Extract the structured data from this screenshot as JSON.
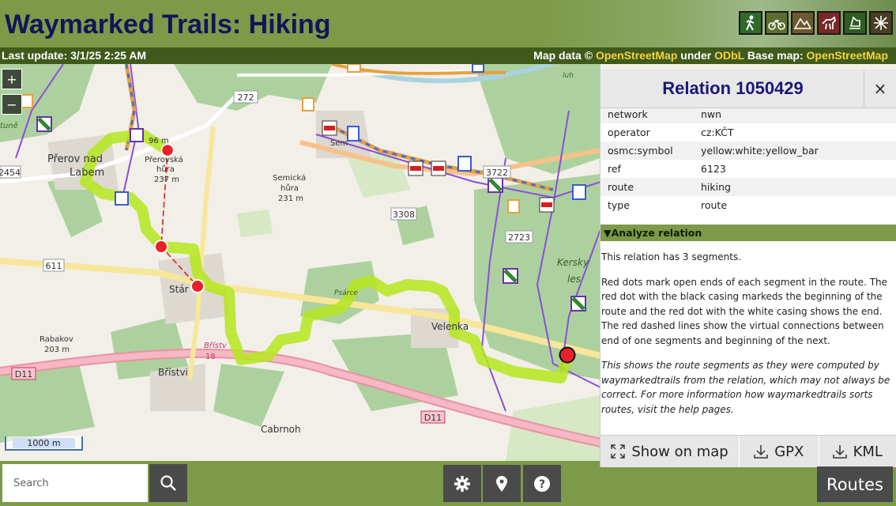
{
  "app": {
    "title": "Waymarked Trails: Hiking",
    "route_types": [
      "hiking-icon",
      "cycling-icon",
      "mtb-icon",
      "riding-icon",
      "skating-icon",
      "slopes-icon"
    ]
  },
  "infobar": {
    "last_update": "Last update: 3/1/25 2:25 AM",
    "map_data_prefix": "Map data ©",
    "osm_link": "OpenStreetMap",
    "under": "under",
    "odbl_link": "ODbL",
    "base_map_prefix": "Base map:",
    "base_map_link": "OpenStreetMap"
  },
  "map": {
    "zoom_in": "+",
    "zoom_out": "−",
    "scale_label": "1000 m",
    "labels": {
      "prerov": "Přerov nad",
      "labem": "Labem",
      "prerovska": "Přerovská",
      "hura": "hůra",
      "h237": "237 m",
      "semicka": "Semická",
      "hura2": "hůra",
      "h231": "231 m",
      "starý": "Stár",
      "rabakov": "Rabakov",
      "h203": "203 m",
      "bristvi": "Břístvi",
      "cabrnoh": "Cabrnoh",
      "velenka": "Velenka",
      "kersky": "Kersky",
      "les": "les",
      "psarce": "Psárce",
      "r272": "272",
      "r3308": "3308",
      "r611": "611",
      "r2454": "2454",
      "r2723": "2723",
      "r3722": "3722",
      "d11a": "D11",
      "d11b": "D11",
      "bristvi_s": "Břístv",
      "n18": "18",
      "sem": "Sem",
      "tune": "tuně",
      "luh": "luh",
      "m96": "96 m"
    }
  },
  "panel": {
    "title": "Relation 1050429",
    "close": "×",
    "tags": [
      {
        "k": "network",
        "v": "nwn"
      },
      {
        "k": "operator",
        "v": "cz:KČT"
      },
      {
        "k": "osmc:symbol",
        "v": "yellow:white:yellow_bar"
      },
      {
        "k": "ref",
        "v": "6123"
      },
      {
        "k": "route",
        "v": "hiking"
      },
      {
        "k": "type",
        "v": "route"
      }
    ],
    "analyze_label": "▼Analyze relation",
    "p1": "This relation has 3 segments.",
    "p2": "Red dots mark open ends of each segment in the route. The red dot with the black casing markeds the beginning of the route and the red dot with the white casing shows the end. The red dashed lines show the virtual connections between end of one segments and beginning of the next.",
    "p3": "This shows the route segments as they were computed by waymarkedtrails from the relation, which may not always be correct. For more information how waymarkedtrails sorts routes, visit the help pages.",
    "show_on_map": "Show on map",
    "gpx": "GPX",
    "kml": "KML"
  },
  "bottom": {
    "search_placeholder": "Search",
    "routes": "Routes"
  },
  "colors": {
    "brand_green": "#7c9a48",
    "dark_green": "#3f5a1b",
    "title_navy": "#14145a",
    "route_highlight": "#b5e61d",
    "endpoint_red": "#e8202a"
  }
}
